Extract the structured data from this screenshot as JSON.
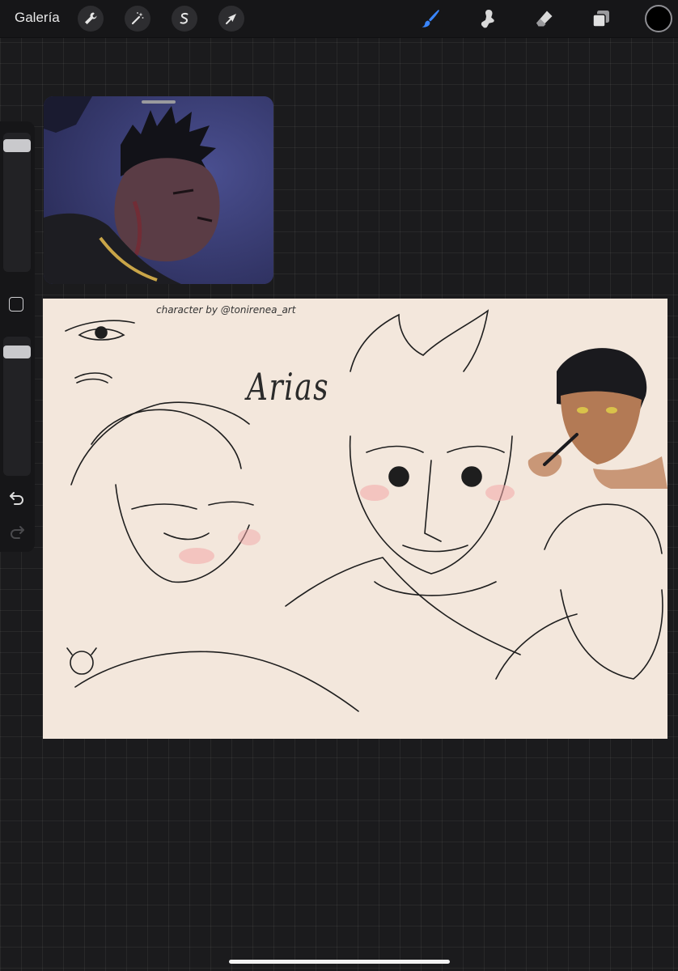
{
  "toolbar": {
    "gallery_label": "Galería",
    "icons": [
      "wrench-icon",
      "magic-wand-icon",
      "selection-icon",
      "transform-arrow-icon",
      "brush-icon",
      "smudge-icon",
      "eraser-icon",
      "layers-icon"
    ],
    "active_tool": "brush",
    "current_color": "#000000"
  },
  "sidebar": {
    "brush_size_level": 0.97,
    "opacity_level": 0.95
  },
  "canvas": {
    "credit_text": "character by @tonirenea_art",
    "name_text": "Arias"
  }
}
